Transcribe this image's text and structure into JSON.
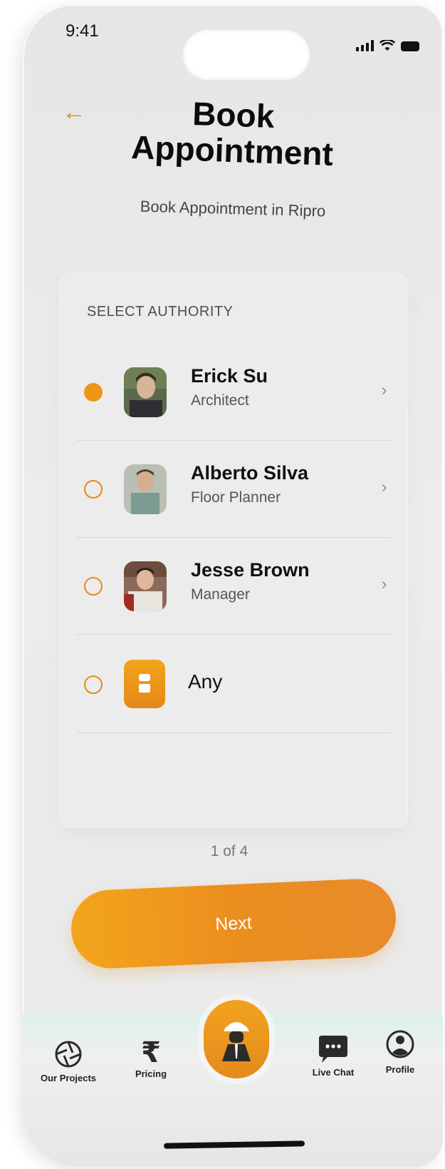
{
  "status_bar": {
    "time": "9:41"
  },
  "header": {
    "title": "Book Appointment",
    "subtitle": "Book Appointment in Ripro"
  },
  "card": {
    "heading": "SELECT AUTHORITY",
    "options": [
      {
        "name": "Erick Su",
        "role": "Architect",
        "selected": true
      },
      {
        "name": "Alberto Silva",
        "role": "Floor Planner",
        "selected": false
      },
      {
        "name": "Jesse Brown",
        "role": "Manager",
        "selected": false
      },
      {
        "name": "Any",
        "role": "",
        "selected": false
      }
    ]
  },
  "pager": "1 of 4",
  "next_button": "Next",
  "tabbar": {
    "items": [
      {
        "label": "Our Projects",
        "icon": "aperture-icon"
      },
      {
        "label": "Pricing",
        "icon": "rupee-icon"
      },
      {
        "label": "",
        "icon": "construction-worker-icon"
      },
      {
        "label": "Live Chat",
        "icon": "chat-bubble-icon"
      },
      {
        "label": "Profile",
        "icon": "user-icon"
      }
    ]
  },
  "colors": {
    "accent": "#EE9618",
    "text": "#111111",
    "muted": "#555555"
  }
}
